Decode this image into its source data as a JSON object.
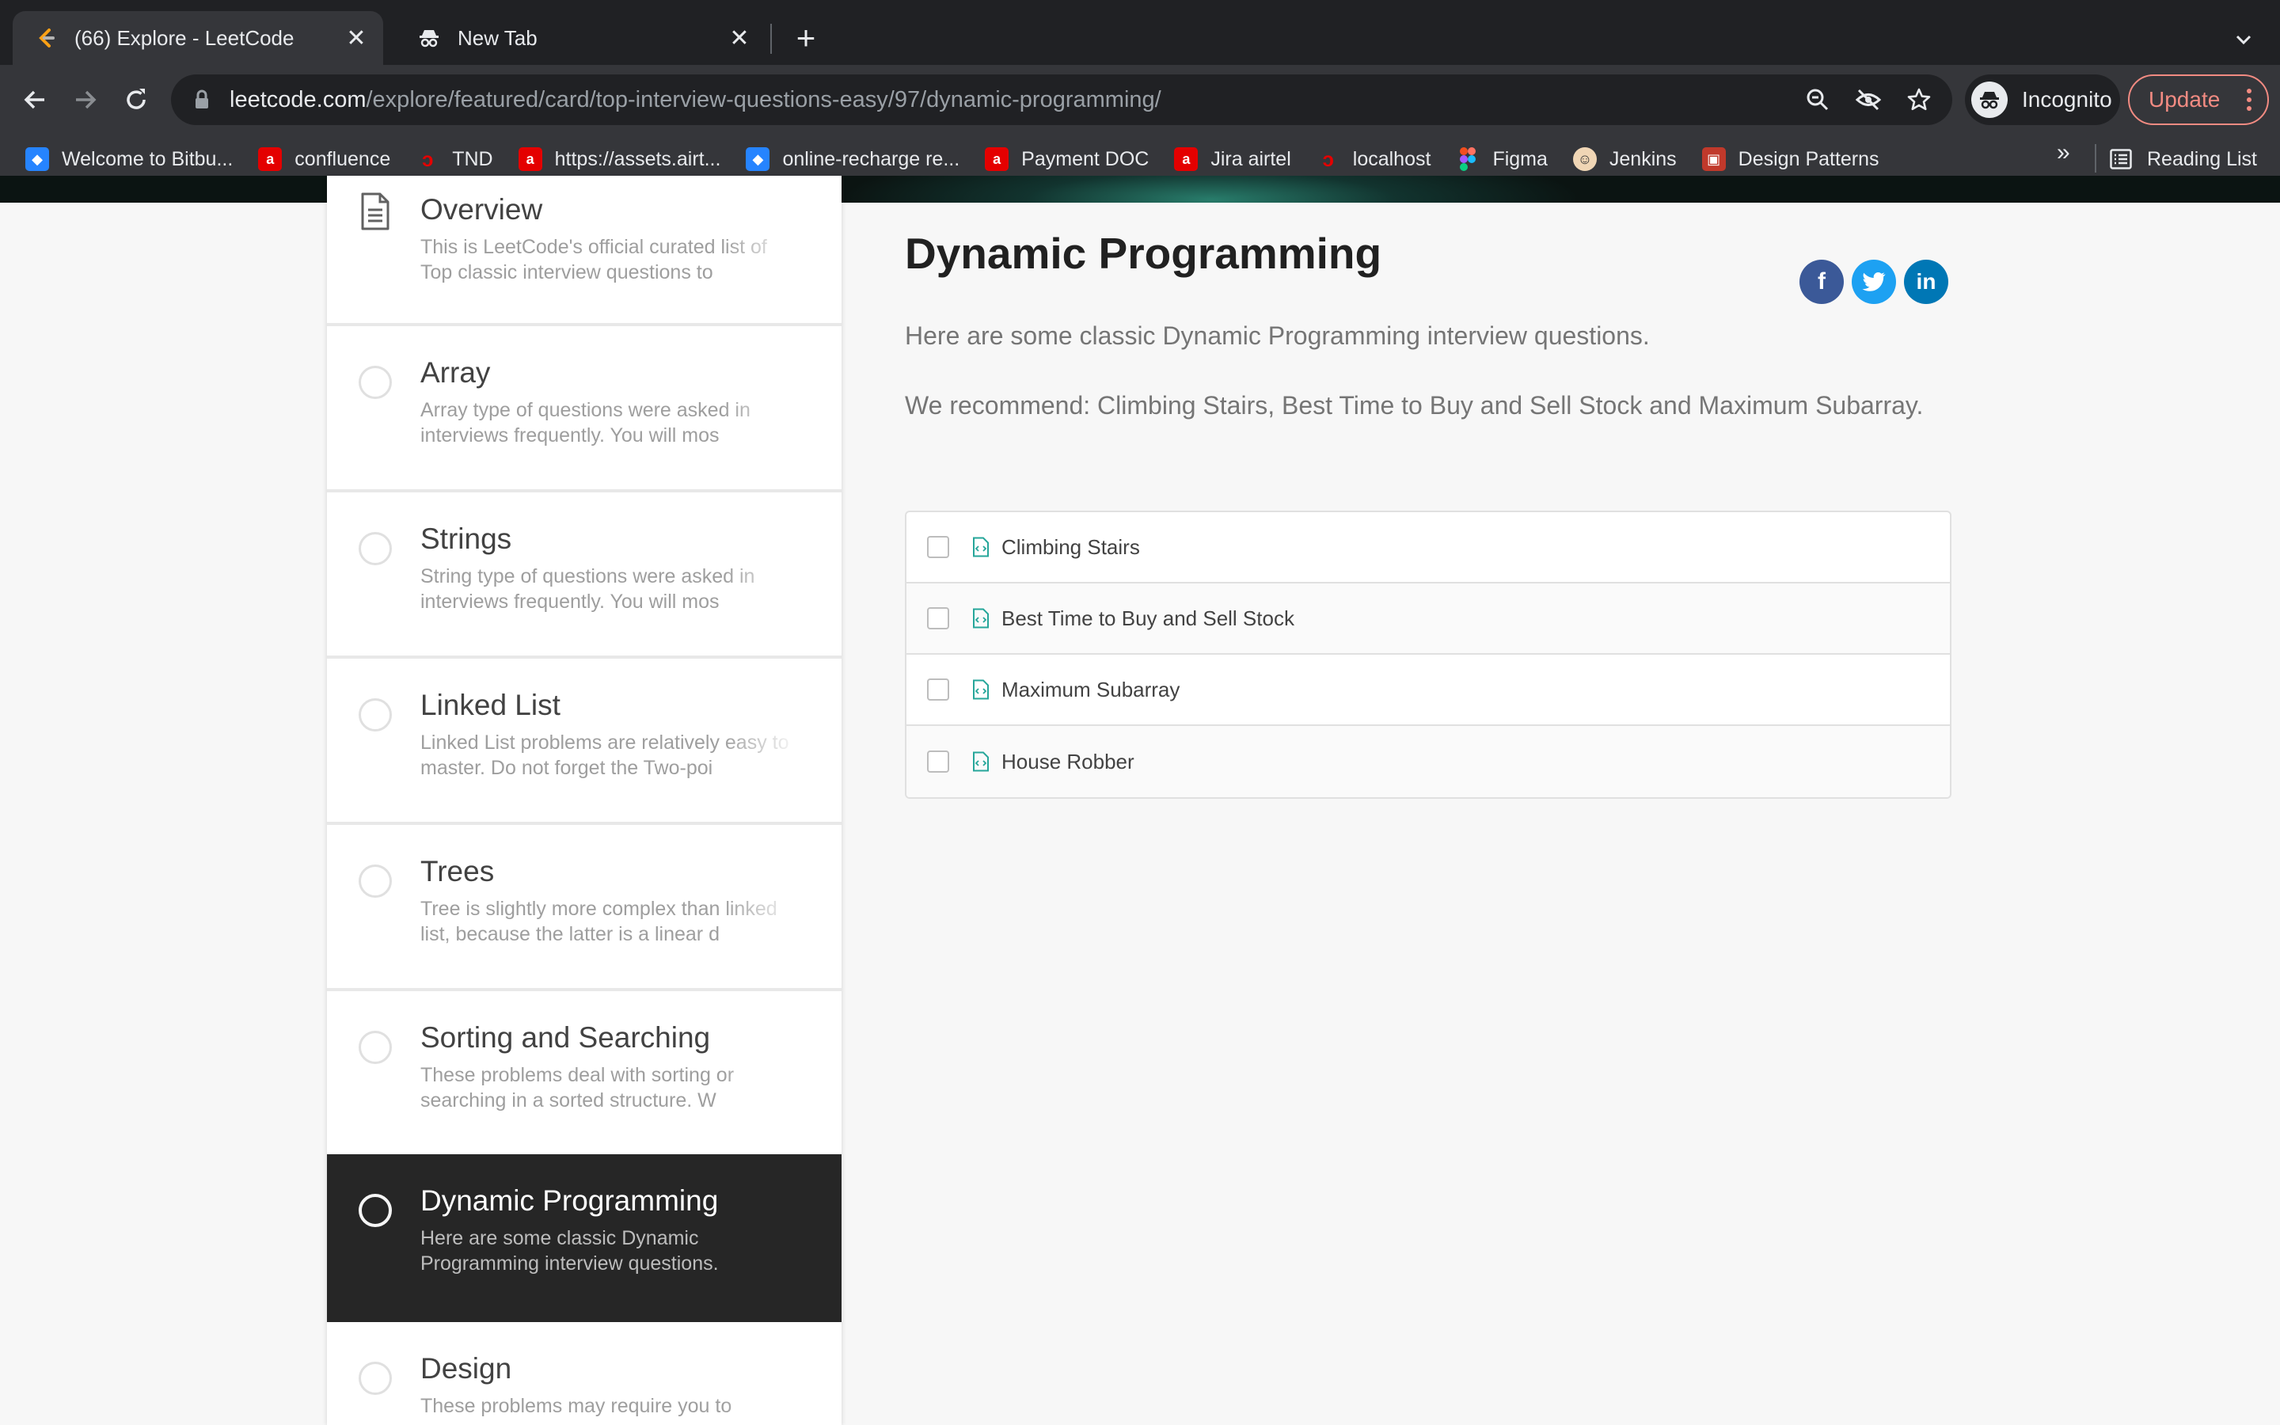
{
  "browser": {
    "tabs": [
      {
        "title": "(66) Explore - LeetCode",
        "active": true
      },
      {
        "title": "New Tab",
        "active": false
      }
    ],
    "new_tab_symbol": "+",
    "url_host": "leetcode.com",
    "url_path": "/explore/featured/card/top-interview-questions-easy/97/dynamic-programming/",
    "incognito_label": "Incognito",
    "update_label": "Update",
    "bookmarks": [
      {
        "label": "Welcome to Bitbu...",
        "icon": "bitbucket-icon",
        "color": "#2684ff"
      },
      {
        "label": "confluence",
        "icon": "airtel-icon",
        "color": "#e40000"
      },
      {
        "label": "TND",
        "icon": "airtel-icon",
        "color": "#e40000"
      },
      {
        "label": "https://assets.airt...",
        "icon": "airtel-icon",
        "color": "#e40000"
      },
      {
        "label": "online-recharge re...",
        "icon": "bitbucket-icon",
        "color": "#2684ff"
      },
      {
        "label": "Payment DOC",
        "icon": "airtel-icon",
        "color": "#e40000"
      },
      {
        "label": "Jira airtel",
        "icon": "airtel-icon",
        "color": "#e40000"
      },
      {
        "label": "localhost",
        "icon": "airtel-icon",
        "color": "#e40000"
      },
      {
        "label": "Figma",
        "icon": "figma-icon",
        "color": "#a259ff"
      },
      {
        "label": "Jenkins",
        "icon": "jenkins-icon",
        "color": "#d33833"
      },
      {
        "label": "Design Patterns",
        "icon": "design-patterns-icon",
        "color": "#c0392b"
      }
    ],
    "bookmarks_overflow": "»",
    "reading_list_label": "Reading List"
  },
  "sidebar": {
    "cards": [
      {
        "title": "Overview",
        "desc_1": "This is LeetCode's official curated list of",
        "desc_2": "Top classic interview questions to",
        "icon": "document-icon",
        "active": false
      },
      {
        "title": "Array",
        "desc_1": "Array type of questions were asked in",
        "desc_2": "interviews frequently. You will mos",
        "icon": "circle-icon",
        "active": false
      },
      {
        "title": "Strings",
        "desc_1": "String type of questions were asked in",
        "desc_2": "interviews frequently. You will mos",
        "icon": "circle-icon",
        "active": false
      },
      {
        "title": "Linked List",
        "desc_1": "Linked List problems are relatively easy to",
        "desc_2": "master. Do not forget the Two-poi",
        "icon": "circle-icon",
        "active": false
      },
      {
        "title": "Trees",
        "desc_1": "Tree is slightly more complex than linked",
        "desc_2": "list, because the latter is a linear d",
        "icon": "circle-icon",
        "active": false
      },
      {
        "title": "Sorting and Searching",
        "desc_1": "These problems deal with sorting or",
        "desc_2": "searching in a sorted structure. W",
        "icon": "circle-icon",
        "active": false
      },
      {
        "title": "Dynamic Programming",
        "desc_1": "Here are some classic Dynamic",
        "desc_2": "Programming interview questions.",
        "icon": "circle-icon",
        "active": true
      },
      {
        "title": "Design",
        "desc_1": "These problems may require you to",
        "desc_2": "",
        "icon": "circle-icon",
        "active": false
      }
    ]
  },
  "main": {
    "title": "Dynamic Programming",
    "intro": "Here are some classic Dynamic Programming interview questions.",
    "recommend": "We recommend: Climbing Stairs, Best Time to Buy and Sell Stock and Maximum Subarray.",
    "share": [
      {
        "label": "f",
        "icon": "facebook-icon",
        "color": "#3b5998"
      },
      {
        "label": "t",
        "icon": "twitter-icon",
        "color": "#1da1f2"
      },
      {
        "label": "in",
        "icon": "linkedin-icon",
        "color": "#0077b5"
      }
    ],
    "questions": [
      {
        "title": "Climbing Stairs"
      },
      {
        "title": "Best Time to Buy and Sell Stock"
      },
      {
        "title": "Maximum Subarray"
      },
      {
        "title": "House Robber"
      }
    ]
  },
  "colors": {
    "active_card_bg": "#262626",
    "question_icon": "#26a69a",
    "update_accent": "#f28b82"
  }
}
